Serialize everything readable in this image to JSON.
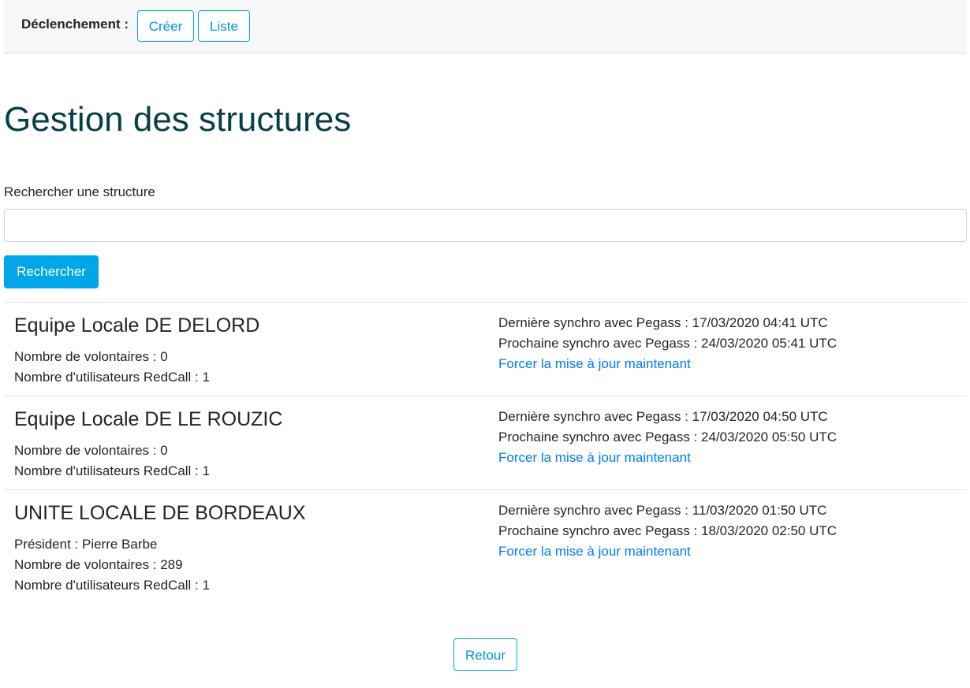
{
  "header": {
    "label": "Déclenchement :",
    "create_label": "Créer",
    "list_label": "Liste"
  },
  "page": {
    "title": "Gestion des structures"
  },
  "search": {
    "label": "Rechercher une structure",
    "value": "",
    "button_label": "Rechercher"
  },
  "structures": [
    {
      "name": "Equipe Locale DE DELORD",
      "president": "",
      "volunteers": "Nombre de volontaires : 0",
      "users": "Nombre d'utilisateurs RedCall : 1",
      "last_sync": "Dernière synchro avec Pegass : 17/03/2020 04:41 UTC",
      "next_sync": "Prochaine synchro avec Pegass : 24/03/2020 05:41 UTC",
      "force_link": "Forcer la mise à jour maintenant"
    },
    {
      "name": "Equipe Locale DE LE ROUZIC",
      "president": "",
      "volunteers": "Nombre de volontaires : 0",
      "users": "Nombre d'utilisateurs RedCall : 1",
      "last_sync": "Dernière synchro avec Pegass : 17/03/2020 04:50 UTC",
      "next_sync": "Prochaine synchro avec Pegass : 24/03/2020 05:50 UTC",
      "force_link": "Forcer la mise à jour maintenant"
    },
    {
      "name": "UNITE LOCALE DE BORDEAUX",
      "president": "Président : Pierre Barbe",
      "volunteers": "Nombre de volontaires : 289",
      "users": "Nombre d'utilisateurs RedCall : 1",
      "last_sync": "Dernière synchro avec Pegass : 11/03/2020 01:50 UTC",
      "next_sync": "Prochaine synchro avec Pegass : 18/03/2020 02:50 UTC",
      "force_link": "Forcer la mise à jour maintenant"
    }
  ],
  "footer": {
    "back_label": "Retour"
  },
  "colors": {
    "accent": "#00a6e8",
    "title": "#053f47",
    "link": "#007bff"
  }
}
